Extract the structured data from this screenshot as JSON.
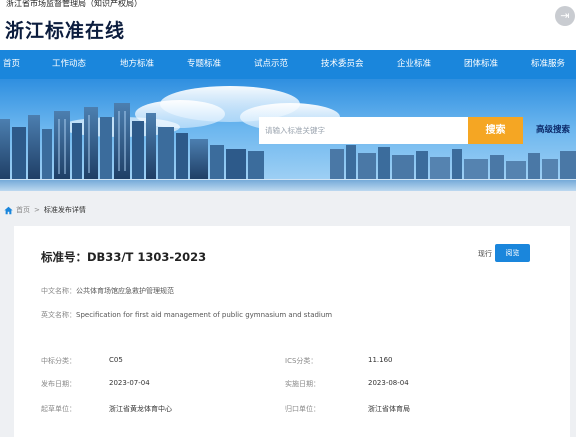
{
  "header": {
    "org": "浙江省市场监督管理局（知识产权局）",
    "site_title": "浙江标准在线",
    "login_icon": "logout-icon"
  },
  "nav": {
    "items": [
      "首页",
      "工作动态",
      "地方标准",
      "专题标准",
      "试点示范",
      "技术委员会",
      "企业标准",
      "团体标准",
      "标准服务"
    ]
  },
  "search": {
    "placeholder": "请输入标准关键字",
    "button": "搜索",
    "advanced": "高级搜索"
  },
  "breadcrumb": {
    "home": "首页",
    "separator": ">",
    "current": "标准发布详情"
  },
  "standard": {
    "number": "标准号：DB33/T 1303-2023",
    "status": "现行",
    "preview_button": "阅览",
    "cn_name_label": "中文名称：",
    "cn_name": "公共体育场馆应急救护管理规范",
    "en_name_label": "英文名称：",
    "en_name": "Specification for first aid management of public gymnasium and stadium",
    "fields": {
      "ccs_label": "中标分类：",
      "ccs": "C05",
      "ics_label": "ICS分类：",
      "ics": "11.160",
      "publish_label": "发布日期：",
      "publish": "2023-07-04",
      "implement_label": "实施日期：",
      "implement": "2023-08-04",
      "drafter_label": "起草单位：",
      "drafter": "浙江省黄龙体育中心",
      "owner_label": "归口单位：",
      "owner": "浙江省体育局"
    }
  },
  "colors": {
    "nav_blue": "#1a86dc",
    "search_orange": "#f5a623",
    "title_navy": "#0c1d3e"
  }
}
